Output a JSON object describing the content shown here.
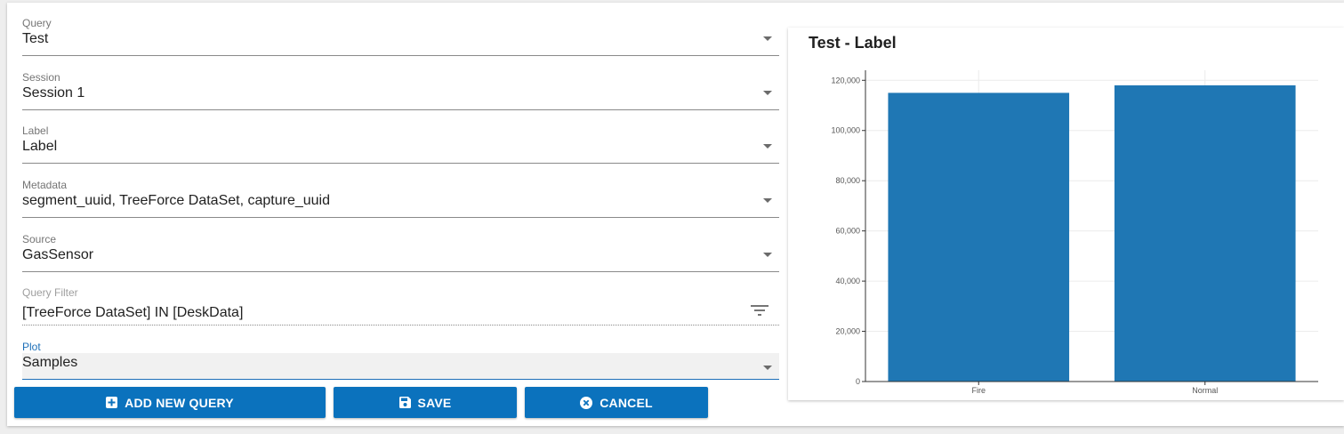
{
  "form": {
    "query": {
      "label": "Query",
      "value": "Test"
    },
    "session": {
      "label": "Session",
      "value": "Session 1"
    },
    "label_field": {
      "label": "Label",
      "value": "Label"
    },
    "metadata": {
      "label": "Metadata",
      "value": "segment_uuid, TreeForce DataSet, capture_uuid"
    },
    "source": {
      "label": "Source",
      "value": "GasSensor"
    },
    "query_filter": {
      "label": "Query Filter",
      "value": "[TreeForce DataSet] IN [DeskData]"
    },
    "plot": {
      "label": "Plot",
      "value": "Samples"
    }
  },
  "buttons": {
    "add_new_query": "ADD NEW QUERY",
    "save": "SAVE",
    "cancel": "CANCEL"
  },
  "colors": {
    "primary": "#0b72bd",
    "bar": "#1f77b4"
  },
  "chart_data": {
    "type": "bar",
    "title": "Test - Label",
    "categories": [
      "Fire",
      "Normal"
    ],
    "values": [
      115000,
      118000
    ],
    "yticks": [
      0,
      20000,
      40000,
      60000,
      80000,
      100000,
      120000
    ],
    "ytick_labels": [
      "0",
      "20,000",
      "40,000",
      "60,000",
      "80,000",
      "100,000",
      "120,000"
    ],
    "ylim": [
      0,
      124000
    ],
    "grid": true,
    "legend": "none"
  }
}
